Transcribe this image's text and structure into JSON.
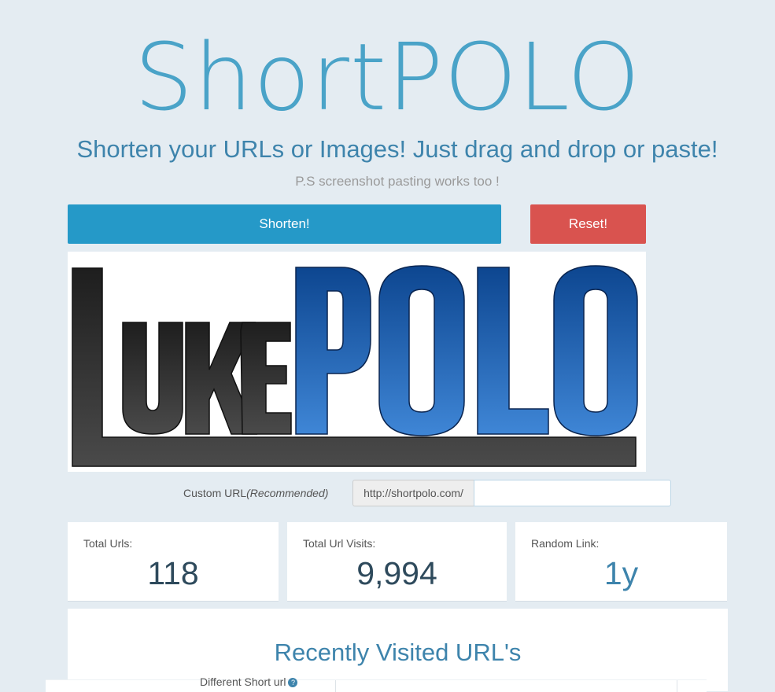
{
  "app": {
    "logo_part1": "Short",
    "logo_part2": "POLO",
    "tagline": "Shorten your URLs or Images! Just drag and drop or paste!",
    "subline": "P.S screenshot pasting works too !"
  },
  "buttons": {
    "shorten": "Shorten!",
    "reset": "Reset!"
  },
  "preview": {
    "image_text_dark": "LUKE",
    "image_text_blue": "POLO"
  },
  "custom_url": {
    "label": "Custom URL",
    "label_note": "(Recommended)",
    "prefix": "http://shortpolo.com/",
    "value": "",
    "placeholder": ""
  },
  "stats": [
    {
      "label": "Total Urls:",
      "value": "118"
    },
    {
      "label": "Total Url Visits:",
      "value": "9,994"
    },
    {
      "label": "Random Link:",
      "value": "1y"
    }
  ],
  "recent": {
    "title": "Recently Visited URL's",
    "column_header": "Different Short url"
  },
  "colors": {
    "accent": "#4aa3c8",
    "primary_button": "#2599c8",
    "danger_button": "#d9534f",
    "background": "#e4ecf2"
  },
  "icons": {
    "help": "help-circle-icon"
  }
}
